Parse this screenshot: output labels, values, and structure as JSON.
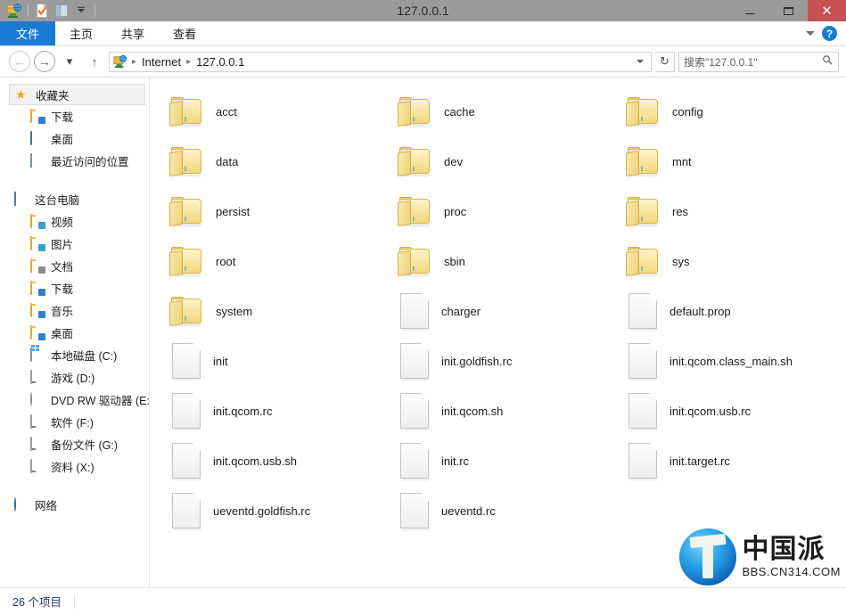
{
  "window": {
    "title": "127.0.0.1",
    "minimize_label": "–",
    "maximize_label": "❐",
    "close_label": "✕"
  },
  "quick_access": {
    "icons": [
      "internet-folder-icon",
      "properties-icon",
      "pane-icon",
      "customize-dropdown-icon"
    ]
  },
  "ribbon": {
    "tabs": [
      {
        "label": "文件",
        "active": true
      },
      {
        "label": "主页",
        "active": false
      },
      {
        "label": "共享",
        "active": false
      },
      {
        "label": "查看",
        "active": false
      }
    ],
    "collapse_icon": "chevron-down-icon",
    "help_label": "?"
  },
  "address_bar": {
    "back_label": "←",
    "forward_label": "→",
    "history_label": "▾",
    "up_label": "↑",
    "crumbs": [
      "Internet",
      "127.0.0.1"
    ],
    "crumb_separator": "▸",
    "refresh_label": "↻",
    "search_placeholder": "搜索\"127.0.0.1\"",
    "search_icon": "⚲"
  },
  "sidebar": {
    "groups": [
      {
        "root": {
          "label": "收藏夹",
          "icon": "star-icon",
          "selected": true
        },
        "items": [
          {
            "label": "下载",
            "icon": "downloads-folder-icon"
          },
          {
            "label": "桌面",
            "icon": "desktop-icon"
          },
          {
            "label": "最近访问的位置",
            "icon": "recent-places-icon"
          }
        ]
      },
      {
        "root": {
          "label": "这台电脑",
          "icon": "this-pc-icon",
          "selected": false
        },
        "items": [
          {
            "label": "视频",
            "icon": "videos-folder-icon"
          },
          {
            "label": "图片",
            "icon": "pictures-folder-icon"
          },
          {
            "label": "文档",
            "icon": "documents-folder-icon"
          },
          {
            "label": "下载",
            "icon": "downloads-folder-icon"
          },
          {
            "label": "音乐",
            "icon": "music-folder-icon"
          },
          {
            "label": "桌面",
            "icon": "desktop-folder-icon"
          },
          {
            "label": "本地磁盘 (C:)",
            "icon": "system-drive-icon"
          },
          {
            "label": "游戏 (D:)",
            "icon": "drive-icon"
          },
          {
            "label": "DVD RW 驱动器 (E:)",
            "icon": "dvd-drive-icon"
          },
          {
            "label": "软件 (F:)",
            "icon": "drive-icon"
          },
          {
            "label": "备份文件 (G:)",
            "icon": "drive-icon"
          },
          {
            "label": "资料 (X:)",
            "icon": "drive-icon"
          }
        ]
      },
      {
        "root": {
          "label": "网络",
          "icon": "network-icon",
          "selected": false
        },
        "items": []
      }
    ]
  },
  "content": {
    "items": [
      {
        "name": "acct",
        "type": "folder"
      },
      {
        "name": "cache",
        "type": "folder"
      },
      {
        "name": "config",
        "type": "folder"
      },
      {
        "name": "data",
        "type": "folder"
      },
      {
        "name": "dev",
        "type": "folder"
      },
      {
        "name": "mnt",
        "type": "folder"
      },
      {
        "name": "persist",
        "type": "folder"
      },
      {
        "name": "proc",
        "type": "folder"
      },
      {
        "name": "res",
        "type": "folder"
      },
      {
        "name": "root",
        "type": "folder"
      },
      {
        "name": "sbin",
        "type": "folder"
      },
      {
        "name": "sys",
        "type": "folder"
      },
      {
        "name": "system",
        "type": "folder"
      },
      {
        "name": "charger",
        "type": "file"
      },
      {
        "name": "default.prop",
        "type": "file"
      },
      {
        "name": "init",
        "type": "file"
      },
      {
        "name": "init.goldfish.rc",
        "type": "file"
      },
      {
        "name": "init.qcom.class_main.sh",
        "type": "file"
      },
      {
        "name": "init.qcom.rc",
        "type": "file"
      },
      {
        "name": "init.qcom.sh",
        "type": "file"
      },
      {
        "name": "init.qcom.usb.rc",
        "type": "file"
      },
      {
        "name": "init.qcom.usb.sh",
        "type": "file"
      },
      {
        "name": "init.rc",
        "type": "file"
      },
      {
        "name": "init.target.rc",
        "type": "file"
      },
      {
        "name": "ueventd.goldfish.rc",
        "type": "file"
      },
      {
        "name": "ueventd.rc",
        "type": "file"
      }
    ]
  },
  "watermark": {
    "brand": "中国派",
    "url": "BBS.CN314.COM"
  },
  "status_bar": {
    "item_count_text": "26 个项目"
  },
  "colors": {
    "titlebar": "#9a9a9a",
    "close_button": "#c75050",
    "accent_blue": "#1b7ad4",
    "status_text": "#1b3a5c"
  }
}
